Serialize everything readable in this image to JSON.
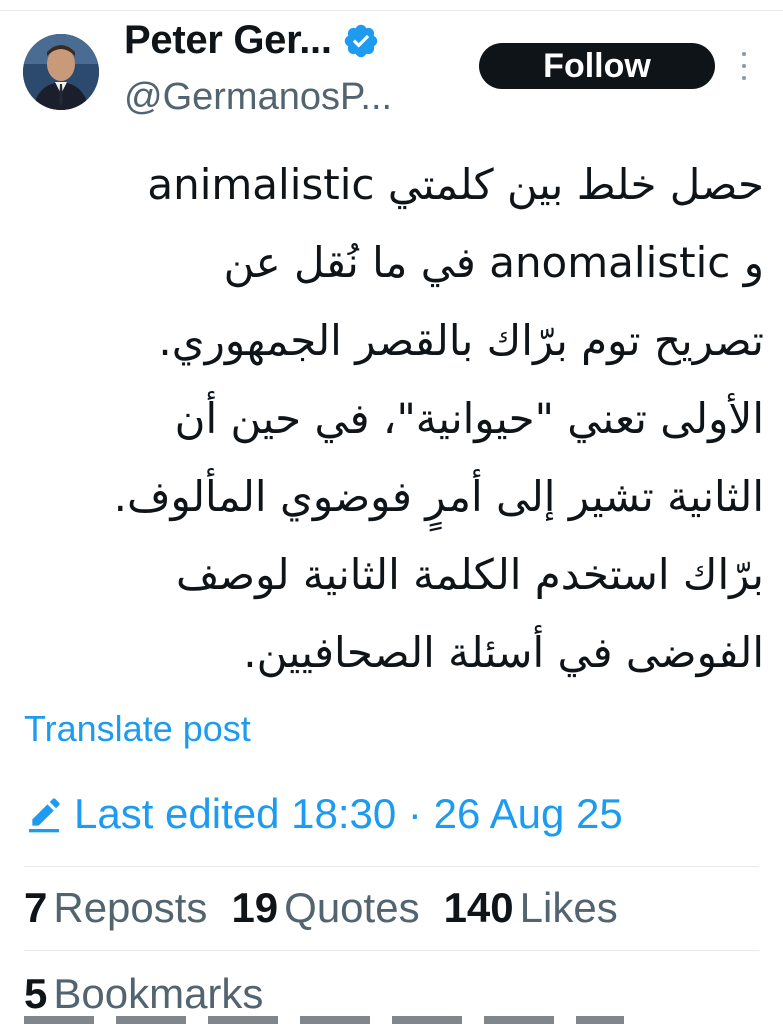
{
  "author": {
    "display_name": "Peter Ger...",
    "handle": "@GermanosP...",
    "verified": true
  },
  "actions": {
    "follow_label": "Follow",
    "more_icon": "more-vertical-icon"
  },
  "post": {
    "lines": [
      "حصل خلط بين كلمتي animalistic",
      "و anomalistic في ما نُقل عن",
      "تصريح توم برّاك بالقصر الجمهوري.",
      "الأولى تعني \"حيوانية\"، في حين أن",
      "الثانية تشير إلى أمرٍ فوضوي المألوف.",
      "برّاك استخدم الكلمة الثانية لوصف",
      "الفوضى في أسئلة الصحافيين."
    ],
    "translate_label": "Translate post",
    "edited_label": "Last edited 18:30 · 26 Aug 25"
  },
  "stats": {
    "reposts": {
      "count": "7",
      "label": "Reposts"
    },
    "quotes": {
      "count": "19",
      "label": "Quotes"
    },
    "likes": {
      "count": "140",
      "label": "Likes"
    },
    "bookmarks": {
      "count": "5",
      "label": "Bookmarks"
    }
  },
  "colors": {
    "accent": "#1d9bf0",
    "text": "#0f1419",
    "secondary": "#536471",
    "follow_bg": "#0f1419"
  }
}
